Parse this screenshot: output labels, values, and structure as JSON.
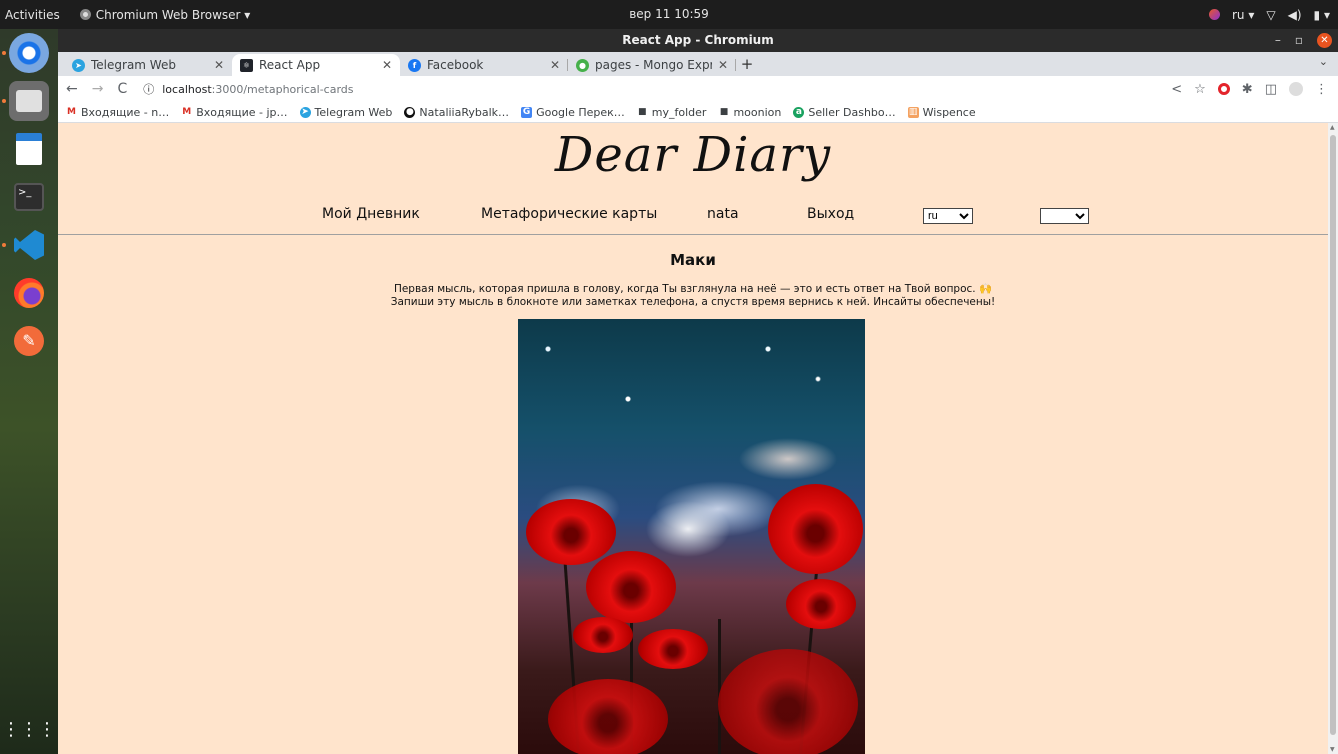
{
  "system": {
    "activities": "Activities",
    "app_menu": "Chromium Web Browser ▾",
    "clock": "вер 11  10:59",
    "lang": "ru ▾"
  },
  "window": {
    "title": "React App - Chromium"
  },
  "tabs": [
    {
      "label": "Telegram Web",
      "icon_color": "#2aa3e0"
    },
    {
      "label": "React App",
      "icon_color": "#20232a"
    },
    {
      "label": "Facebook",
      "icon_color": "#1877f2"
    },
    {
      "label": "pages - Mongo Express",
      "icon_color": "#45b04a"
    }
  ],
  "toolbar": {
    "url_host": "localhost",
    "url_path": ":3000/metaphorical-cards"
  },
  "bookmarks": [
    {
      "label": "Входящие - n…",
      "icon": "gmail-icon",
      "color": "#d93025"
    },
    {
      "label": "Входящие - jp…",
      "icon": "gmail-icon",
      "color": "#d93025"
    },
    {
      "label": "Telegram Web",
      "icon": "telegram-icon",
      "color": "#2aa3e0"
    },
    {
      "label": "NataliiaRybalk…",
      "icon": "github-icon",
      "color": "#111111"
    },
    {
      "label": "Google Перек…",
      "icon": "translate-icon",
      "color": "#4285f4"
    },
    {
      "label": "my_folder",
      "icon": "folder-icon",
      "color": "#3c4043"
    },
    {
      "label": "moonion",
      "icon": "folder-icon",
      "color": "#3c4043"
    },
    {
      "label": "Seller Dashbo…",
      "icon": "seller-icon",
      "color": "#1aa260"
    },
    {
      "label": "Wispence",
      "icon": "wispence-icon",
      "color": "#f4a261"
    }
  ],
  "site": {
    "brand": "Dear Diary",
    "nav": {
      "diary": "Мой Дневник",
      "cards": "Метафорические карты",
      "user": "nata",
      "logout": "Выход",
      "lang_value": "ru",
      "second_select_value": ""
    },
    "card": {
      "title": "Маки",
      "text_line1": "Первая мысль, которая пришла в голову, когда Ты взглянула на неё — это и есть ответ на Твой вопрос. 🙌",
      "text_line2": "Запиши эту мысль в блокноте или заметках телефона, а спустя время вернись к ней. Инсайты обеспечены!"
    }
  }
}
